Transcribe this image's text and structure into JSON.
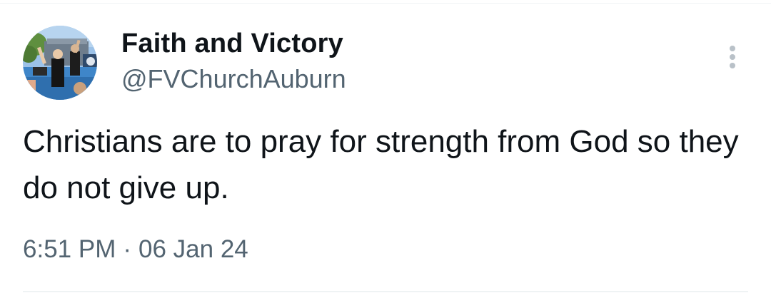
{
  "tweet": {
    "author": {
      "display_name": "Faith and Victory",
      "handle": "@FVChurchAuburn"
    },
    "text": "Christians are to pray for strength from God so they do not give up.",
    "meta": {
      "time": "6:51 PM",
      "separator": "·",
      "date": "06 Jan 24"
    },
    "more_icon": "more-vertical-icon"
  },
  "colors": {
    "primary_text": "#0f1419",
    "secondary_text": "#536471",
    "divider": "#eff3f4"
  }
}
